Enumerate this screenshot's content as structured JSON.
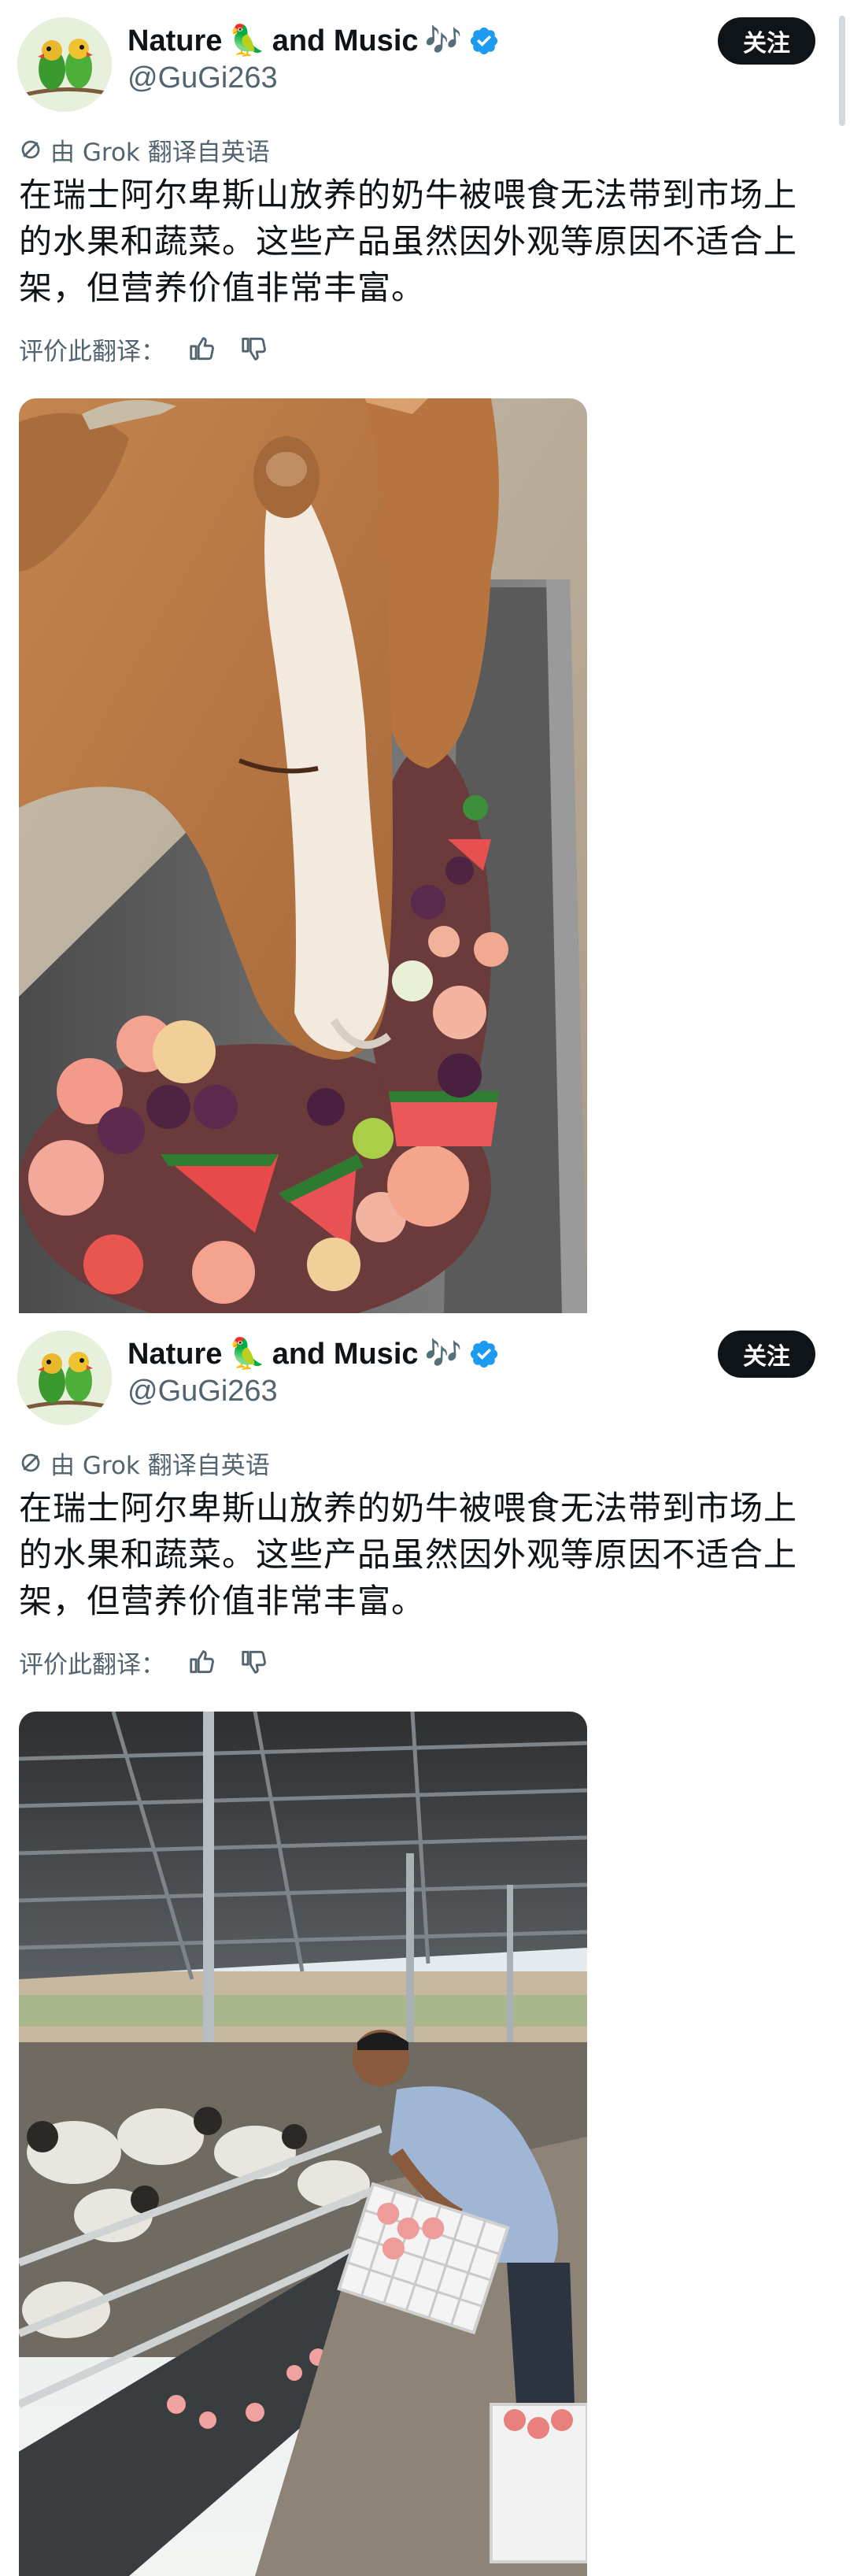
{
  "posts": [
    {
      "author": {
        "name_part1": "Nature",
        "emoji_bird": "🦜",
        "name_part2": "and Music",
        "emoji_music": "🎶",
        "handle": "@GuGi263"
      },
      "follow_label": "关注",
      "translation_note": "由 Grok 翻译自英语",
      "text": "在瑞士阿尔卑斯山放养的奶牛被喂食无法带到市场上的水果和蔬菜。这些产品虽然因外观等原因不适合上架，但营养价值非常丰富。",
      "rate_label": "评价此翻译：",
      "media_icon": "cow-eating-fruit-photo"
    },
    {
      "author": {
        "name_part1": "Nature",
        "emoji_bird": "🦜",
        "name_part2": "and Music",
        "emoji_music": "🎶",
        "handle": "@GuGi263"
      },
      "follow_label": "关注",
      "translation_note": "由 Grok 翻译自英语",
      "text": "在瑞士阿尔卑斯山放养的奶牛被喂食无法带到市场上的水果和蔬菜。这些产品虽然因外观等原因不适合上架，但营养价值非常丰富。",
      "rate_label": "评价此翻译：",
      "media_icon": "barn-feeding-photo"
    }
  ],
  "colors": {
    "text": "#0f1419",
    "secondary": "#536471",
    "verified": "#1d9bf0",
    "follow_bg": "#0f1419"
  },
  "icons": {
    "avatar": "lovebirds-avatar",
    "verified": "verified-badge-icon",
    "translate": "grok-icon",
    "like": "thumbs-up-icon",
    "dislike": "thumbs-down-icon"
  }
}
